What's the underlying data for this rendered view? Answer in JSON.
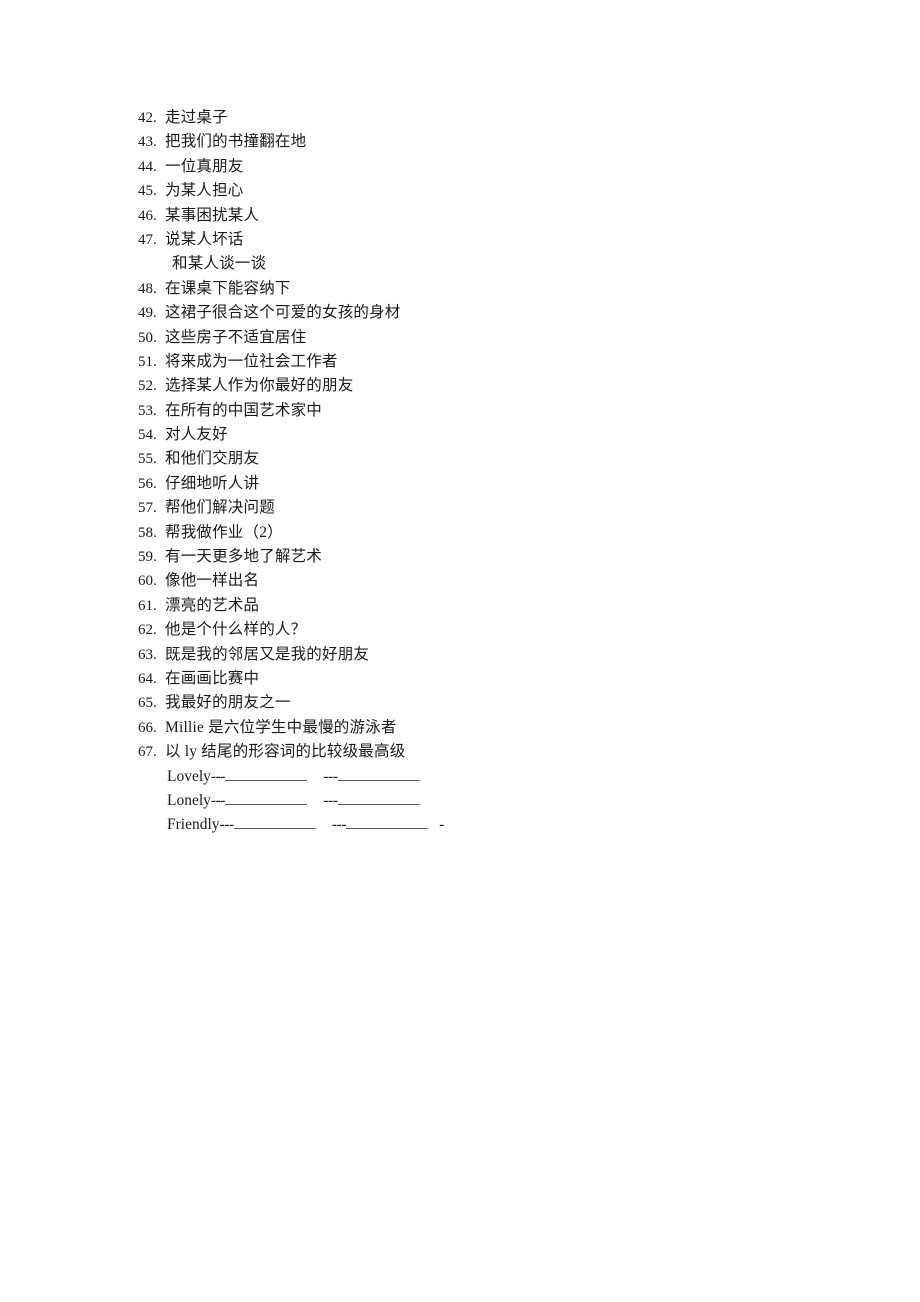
{
  "document": {
    "items": [
      {
        "num": "42.",
        "text": "走过桌子"
      },
      {
        "num": "43.",
        "text": "把我们的书撞翻在地"
      },
      {
        "num": "44.",
        "text": "一位真朋友"
      },
      {
        "num": "45.",
        "text": "为某人担心"
      },
      {
        "num": "46.",
        "text": "某事困扰某人"
      },
      {
        "num": "47.",
        "text": "说某人坏话"
      },
      {
        "num": "48.",
        "text": "在课桌下能容纳下"
      },
      {
        "num": "49.",
        "text": "这裙子很合这个可爱的女孩的身材"
      },
      {
        "num": "50.",
        "text": "这些房子不适宜居住"
      },
      {
        "num": "51.",
        "text": "将来成为一位社会工作者"
      },
      {
        "num": "52.",
        "text": "选择某人作为你最好的朋友"
      },
      {
        "num": "53.",
        "text": "在所有的中国艺术家中"
      },
      {
        "num": "54.",
        "text": "对人友好"
      },
      {
        "num": "55.",
        "text": "和他们交朋友"
      },
      {
        "num": "56.",
        "text": "仔细地听人讲"
      },
      {
        "num": "57.",
        "text": "帮他们解决问题"
      },
      {
        "num": "58.",
        "text": "帮我做作业（2）"
      },
      {
        "num": "59.",
        "text": "有一天更多地了解艺术"
      },
      {
        "num": "60.",
        "text": "像他一样出名"
      },
      {
        "num": "61.",
        "text": "漂亮的艺术品"
      },
      {
        "num": "62.",
        "text": "他是个什么样的人？"
      },
      {
        "num": "63.",
        "text": "既是我的邻居又是我的好朋友"
      },
      {
        "num": "64.",
        "text": "在画画比赛中"
      },
      {
        "num": "65.",
        "text": "我最好的朋友之一"
      },
      {
        "num": "66.",
        "text": "Millie  是六位学生中最慢的游泳者"
      },
      {
        "num": "67.",
        "text": "以 ly 结尾的形容词的比较级最高级"
      }
    ],
    "subline_after_47": "和某人谈一谈",
    "blanks": {
      "dashes": "---",
      "trailing_dash": "-",
      "rows": [
        {
          "word": "Lovely",
          "blank1": "",
          "blank2": "",
          "trailing": ""
        },
        {
          "word": "Lonely",
          "blank1": "",
          "blank2": "",
          "trailing": ""
        },
        {
          "word": "Friendly",
          "blank1": "",
          "blank2": "",
          "trailing": "-"
        }
      ]
    }
  }
}
